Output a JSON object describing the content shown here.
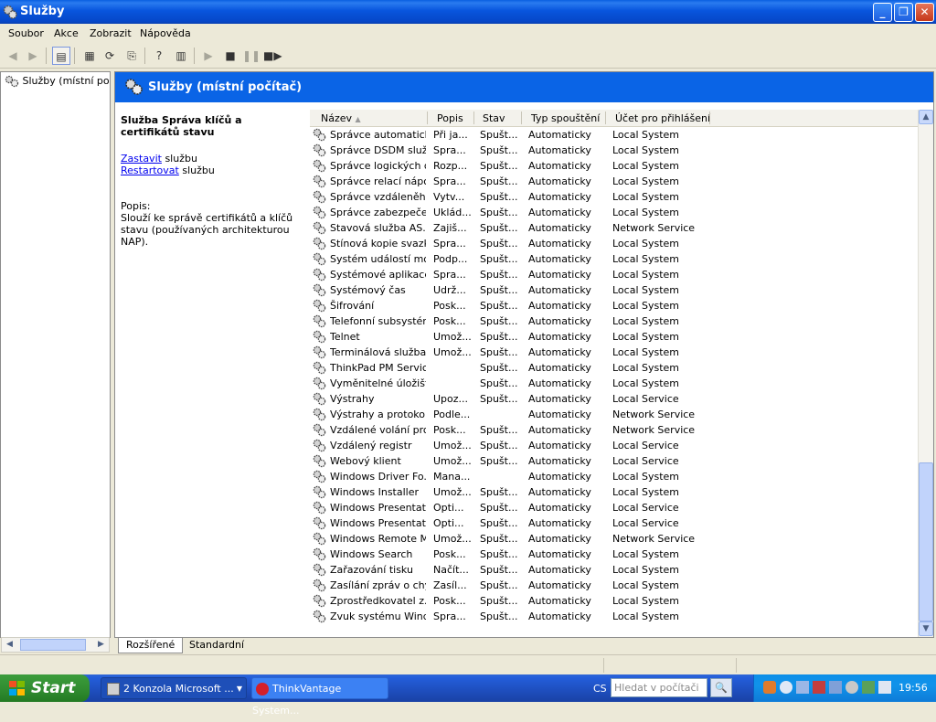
{
  "window": {
    "title": "Služby"
  },
  "menu": [
    "Soubor",
    "Akce",
    "Zobrazit",
    "Nápověda"
  ],
  "tree": {
    "item": "Služby (místní počíta"
  },
  "header": {
    "title": "Služby (místní počítač)"
  },
  "description": {
    "service_title": "Služba Správa klíčů a certifikátů stavu",
    "stop_link": "Zastavit",
    "stop_suffix": " službu",
    "restart_link": "Restartovat",
    "restart_suffix": " službu",
    "desc_label": "Popis:",
    "desc_text": "Slouží ke správě certifikátů a klíčů stavu (používaných architekturou NAP)."
  },
  "columns": [
    "Název",
    "Popis",
    "Stav",
    "Typ spouštění",
    "Účet pro přihlášení"
  ],
  "rows": [
    [
      "Správce automatick...",
      "Při ja...",
      "Spušt...",
      "Automaticky",
      "Local System"
    ],
    [
      "Správce DSDM služ...",
      "Spra...",
      "Spušt...",
      "Automaticky",
      "Local System"
    ],
    [
      "Správce logických d...",
      "Rozp...",
      "Spušt...",
      "Automaticky",
      "Local System"
    ],
    [
      "Správce relací nápo...",
      "Spra...",
      "Spušt...",
      "Automaticky",
      "Local System"
    ],
    [
      "Správce vzdáleněh...",
      "Vytv...",
      "Spušt...",
      "Automaticky",
      "Local System"
    ],
    [
      "Správce zabezpeče...",
      "Uklád...",
      "Spušt...",
      "Automaticky",
      "Local System"
    ],
    [
      "Stavová služba AS...",
      "Zajiš...",
      "Spušt...",
      "Automaticky",
      "Network Service"
    ],
    [
      "Stínová kopie svazku",
      "Spra...",
      "Spušt...",
      "Automaticky",
      "Local System"
    ],
    [
      "Systém událostí mo...",
      "Podp...",
      "Spušt...",
      "Automaticky",
      "Local System"
    ],
    [
      "Systémové aplikace...",
      "Spra...",
      "Spušt...",
      "Automaticky",
      "Local System"
    ],
    [
      "Systémový čas",
      "Udrž...",
      "Spušt...",
      "Automaticky",
      "Local System"
    ],
    [
      "Šifrování",
      "Posk...",
      "Spušt...",
      "Automaticky",
      "Local System"
    ],
    [
      "Telefonní subsystém",
      "Posk...",
      "Spušt...",
      "Automaticky",
      "Local System"
    ],
    [
      "Telnet",
      "Umož...",
      "Spušt...",
      "Automaticky",
      "Local System"
    ],
    [
      "Terminálová služba",
      "Umož...",
      "Spušt...",
      "Automaticky",
      "Local System"
    ],
    [
      "ThinkPad PM Service",
      "",
      "Spušt...",
      "Automaticky",
      "Local System"
    ],
    [
      "Vyměnitelné úložiště",
      "",
      "Spušt...",
      "Automaticky",
      "Local System"
    ],
    [
      "Výstrahy",
      "Upoz...",
      "Spušt...",
      "Automaticky",
      "Local Service"
    ],
    [
      "Výstrahy a protokol...",
      "Podle...",
      "",
      "Automaticky",
      "Network Service"
    ],
    [
      "Vzdálené volání pro...",
      "Posk...",
      "Spušt...",
      "Automaticky",
      "Network Service"
    ],
    [
      "Vzdálený registr",
      "Umož...",
      "Spušt...",
      "Automaticky",
      "Local Service"
    ],
    [
      "Webový klient",
      "Umož...",
      "Spušt...",
      "Automaticky",
      "Local Service"
    ],
    [
      "Windows Driver Fo...",
      "Mana...",
      "",
      "Automaticky",
      "Local System"
    ],
    [
      "Windows Installer",
      "Umož...",
      "Spušt...",
      "Automaticky",
      "Local System"
    ],
    [
      "Windows Presentat...",
      "Opti...",
      "Spušt...",
      "Automaticky",
      "Local Service"
    ],
    [
      "Windows Presentat...",
      "Opti...",
      "Spušt...",
      "Automaticky",
      "Local Service"
    ],
    [
      "Windows Remote M...",
      "Umož...",
      "Spušt...",
      "Automaticky",
      "Network Service"
    ],
    [
      "Windows Search",
      "Posk...",
      "Spušt...",
      "Automaticky",
      "Local System"
    ],
    [
      "Zařazování tisku",
      "Načít...",
      "Spušt...",
      "Automaticky",
      "Local System"
    ],
    [
      "Zasílání zpráv o chy...",
      "Zasíl...",
      "Spušt...",
      "Automaticky",
      "Local System"
    ],
    [
      "Zprostředkovatel z...",
      "Posk...",
      "Spušt...",
      "Automaticky",
      "Local System"
    ],
    [
      "Zvuk systému Wind...",
      "Spra...",
      "Spušt...",
      "Automaticky",
      "Local System"
    ]
  ],
  "tabs": [
    "Rozšířené",
    "Standardní"
  ],
  "taskbar": {
    "start": "Start",
    "task1": "2 Konzola Microsoft ...",
    "task2": "ThinkVantage System...",
    "lang": "CS",
    "search_placeholder": "Hledat v počítači",
    "clock": "19:56"
  },
  "colors": {
    "title_blue": "#0a5fe0",
    "header_blue": "#0a64e6",
    "start_green": "#3c9d3c"
  }
}
